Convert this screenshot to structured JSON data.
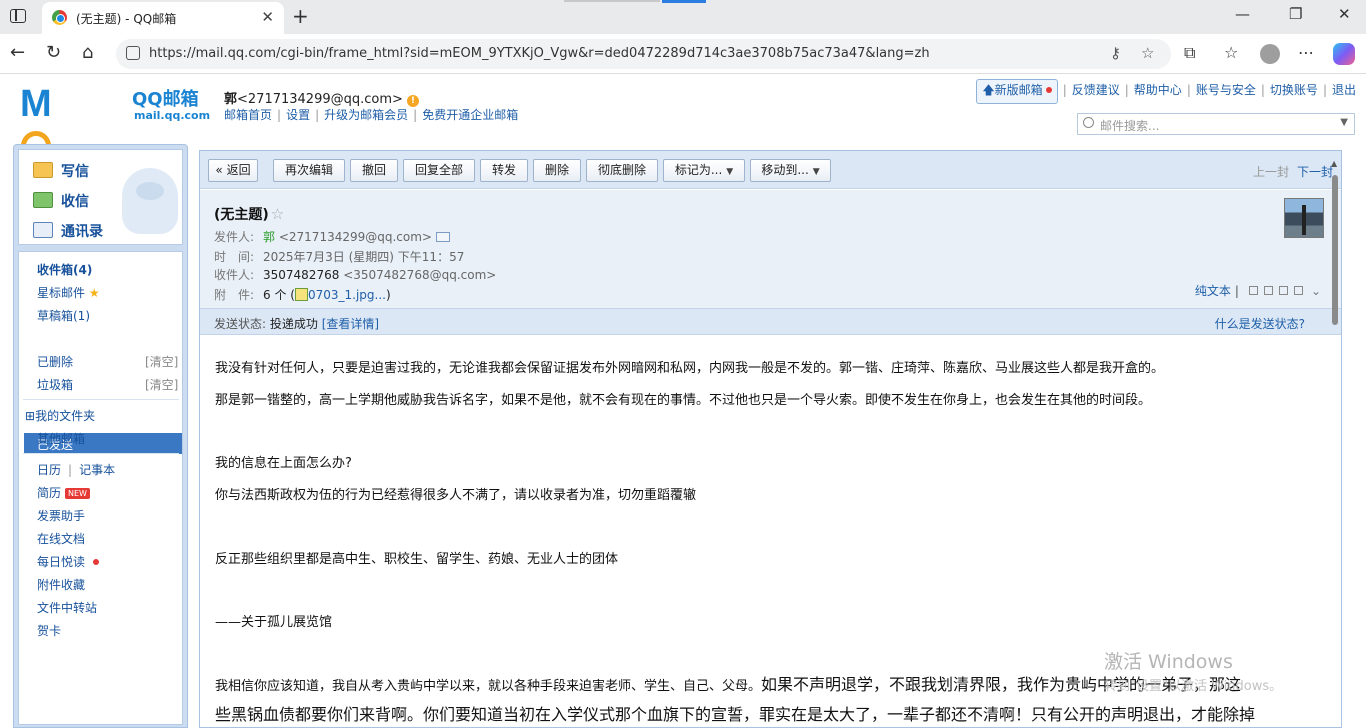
{
  "browser": {
    "tab_title": "(无主题) - QQ邮箱",
    "tab_close": "✕",
    "new_tab": "+",
    "url": "https://mail.qq.com/cgi-bin/frame_html?sid=mEOM_9YTXKjO_Vgw&r=ded0472289d714c3ae3708b75ac73a47&lang=zh",
    "window_controls": [
      "—",
      "❐",
      "✕"
    ],
    "icons": [
      "back-icon",
      "reload-icon",
      "home-icon",
      "key-icon",
      "star-icon",
      "extensions-icon",
      "favorites-icon",
      "profile-icon",
      "menu-icon",
      "copilot-icon"
    ]
  },
  "logo": {
    "mark_left": "M",
    "mark_right": "il",
    "cn": "QQ邮箱",
    "en": "mail.qq.com"
  },
  "account": {
    "name": "郭",
    "email": "<2717134299@qq.com>",
    "warn": "!"
  },
  "sub_links": [
    "邮箱首页",
    "设置",
    "升级为邮箱会员",
    "免费开通企业邮箱"
  ],
  "top_links": {
    "new_version": "新版邮箱",
    "items": [
      "反馈建议",
      "帮助中心",
      "账号与安全",
      "切换账号",
      "退出"
    ]
  },
  "search": {
    "placeholder": "邮件搜索..."
  },
  "sidebar": {
    "compose": "写信",
    "receive": "收信",
    "contacts": "通讯录",
    "folders": {
      "inbox": "收件箱(4)",
      "starred": "星标邮件",
      "drafts": "草稿箱(1)",
      "sent": "已发送",
      "deleted": "已删除",
      "spam": "垃圾箱",
      "clear": "[清空]",
      "my_folders": "我的文件夹",
      "my_folders_toggle": "⊞",
      "other_mailbox": "其他邮箱",
      "calendar": "日历",
      "notepad": "记事本",
      "resume": "简历",
      "new_badge": "NEW",
      "invoice": "发票助手",
      "docs": "在线文档",
      "daily": "每日悦读",
      "attachments": "附件收藏",
      "transfer": "文件中转站",
      "cards": "贺卡"
    }
  },
  "toolbar": {
    "back": "« 返回",
    "reedit": "再次编辑",
    "undo": "撤回",
    "reply_all": "回复全部",
    "forward": "转发",
    "delete": "删除",
    "purge": "彻底删除",
    "mark_as": "标记为...",
    "move_to": "移动到...",
    "prev": "上一封",
    "next": "下一封"
  },
  "mail": {
    "subject": "(无主题)",
    "sender_label": "发件人:",
    "sender_name": "郭",
    "sender_email": "<2717134299@qq.com>",
    "time_label": "时　间:",
    "time": "2025年7月3日 (星期四) 下午11：57",
    "to_label": "收件人:",
    "to_name": "3507482768",
    "to_email": "<3507482768@qq.com>",
    "attach_label": "附　件:",
    "attach_count": "6 个 (",
    "attach_name": "0703_1.jpg...",
    "attach_close": ")",
    "plain_text": "纯文本",
    "send_status_label": "发送状态:",
    "send_status": "投递成功",
    "send_detail": "[查看详情]",
    "what_status": "什么是发送状态?"
  },
  "body": {
    "p1": "我没有针对任何人，只要是迫害过我的，无论谁我都会保留证据发布外网暗网和私网，内网我一般是不发的。郭一锴、庄琦萍、陈嘉欣、马业展这些人都是我开盒的。",
    "p2": "那是郭一锴整的，高一上学期他威胁我告诉名字，如果不是他，就不会有现在的事情。不过他也只是一个导火索。即使不发生在你身上，也会发生在其他的时间段。",
    "p3": "我的信息在上面怎么办?",
    "p4": "你与法西斯政权为伍的行为已经惹得很多人不满了，请以收录者为准，切勿重蹈覆辙",
    "p5": "反正那些组织里都是高中生、职校生、留学生、药娘、无业人士的团体",
    "p6": "——关于孤儿展览馆",
    "p7_small": "我相信你应该知道，我自从考入贵屿中学以来，就以各种手段来迫害老师、学生、自己、父母。",
    "p7_big": "如果不声明退学，不跟我划清界限，我作为贵屿中学的一弟子，那这",
    "p8": "些黑锅血债都要你们来背啊。你们要知道当初在入学仪式那个血旗下的宣誓，罪实在是太大了，一辈子都还不清啊！只有公开的声明退出，才能除掉"
  },
  "watermark": {
    "line1": "激活 Windows",
    "line2": "转到\"设置\"以激活 Windows。"
  }
}
